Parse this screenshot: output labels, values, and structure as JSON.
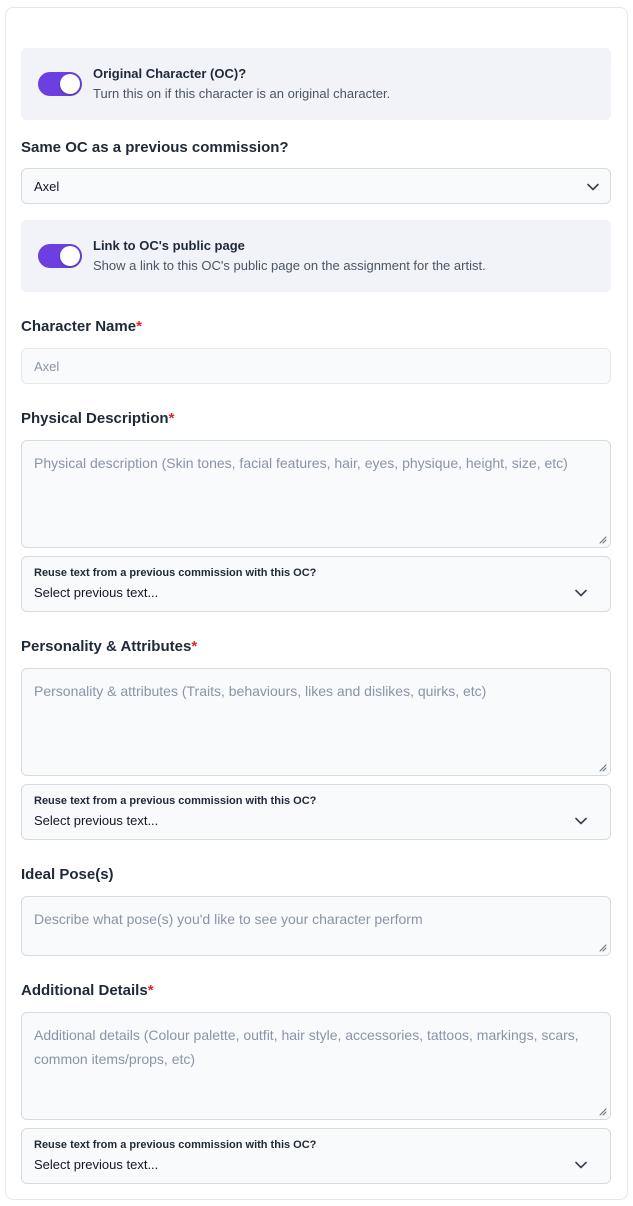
{
  "oc_toggle": {
    "title": "Original Character (OC)?",
    "description": "Turn this on if this character is an original character.",
    "checked": true
  },
  "previous_commission": {
    "label": "Same OC as a previous commission?",
    "selected": "Axel"
  },
  "public_page_toggle": {
    "title": "Link to OC's public page",
    "description": "Show a link to this OC's public page on the assignment for the artist.",
    "checked": true
  },
  "character_name": {
    "label": "Character Name",
    "required_mark": "*",
    "placeholder": "Axel"
  },
  "physical_description": {
    "label": "Physical Description",
    "required_mark": "*",
    "placeholder": "Physical description (Skin tones, facial features, hair, eyes, physique, height, size, etc)",
    "reuse_label": "Reuse text from a previous commission with this OC?",
    "reuse_value": "Select previous text..."
  },
  "personality": {
    "label": "Personality & Attributes",
    "required_mark": "*",
    "placeholder": "Personality & attributes (Traits, behaviours, likes and dislikes, quirks, etc)",
    "reuse_label": "Reuse text from a previous commission with this OC?",
    "reuse_value": "Select previous text..."
  },
  "ideal_pose": {
    "label": "Ideal Pose(s)",
    "placeholder": "Describe what pose(s) you'd like to see your character perform"
  },
  "additional_details": {
    "label": "Additional Details",
    "required_mark": "*",
    "placeholder": "Additional details (Colour palette, outfit, hair style, accessories, tattoos, markings, scars, common items/props, etc)",
    "reuse_label": "Reuse text from a previous commission with this OC?",
    "reuse_value": "Select previous text..."
  },
  "colors": {
    "accent": "#6b3fe0",
    "required": "#dc2626",
    "panel": "#f1f3f8"
  }
}
